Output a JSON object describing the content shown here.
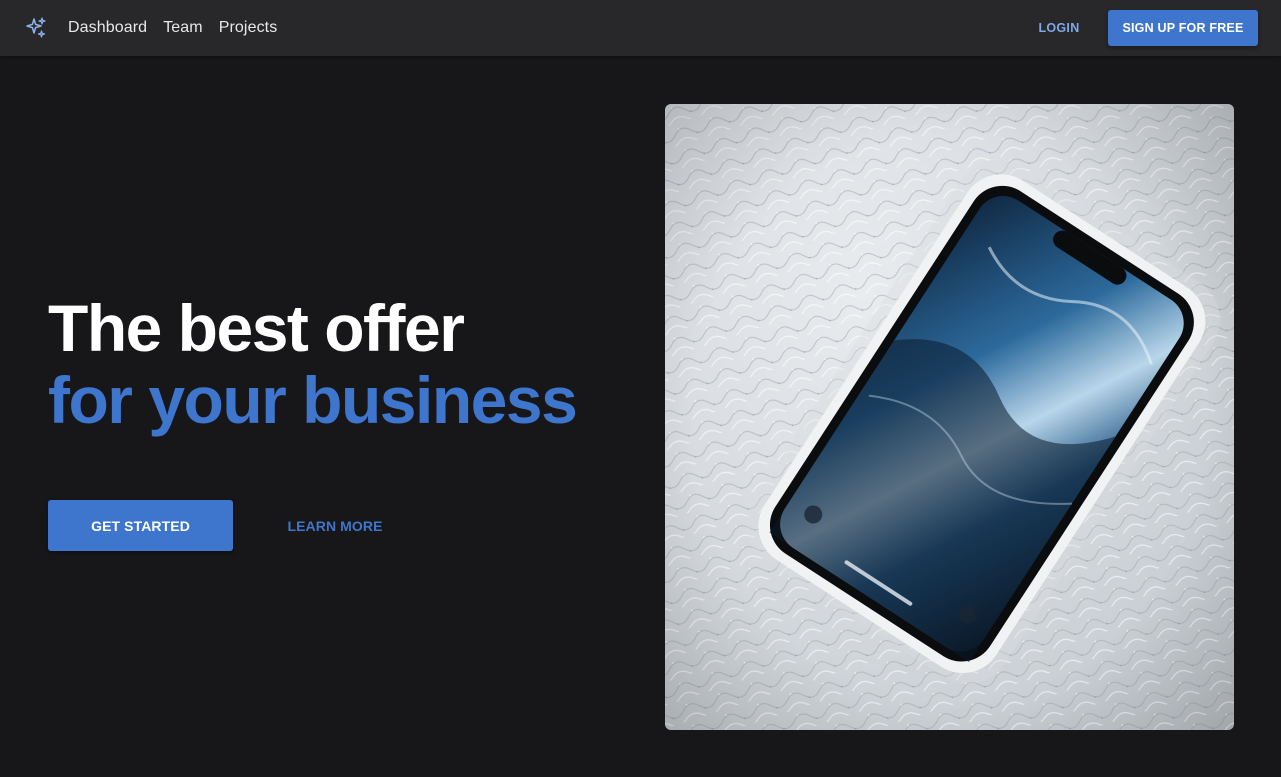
{
  "nav": {
    "logo_icon": "sparkles-icon",
    "links": [
      {
        "label": "Dashboard"
      },
      {
        "label": "Team"
      },
      {
        "label": "Projects"
      }
    ],
    "login_label": "LOGIN",
    "signup_label": "SIGN UP FOR FREE"
  },
  "hero": {
    "title_line1": "The best offer",
    "title_line2": "for your business",
    "primary_cta": "GET STARTED",
    "secondary_cta": "LEARN MORE",
    "image_icon": "smartphone-photo"
  },
  "colors": {
    "accent": "#3e75cd",
    "background": "#171719",
    "navbar": "#28282a",
    "login_text": "#7fa8e8"
  }
}
